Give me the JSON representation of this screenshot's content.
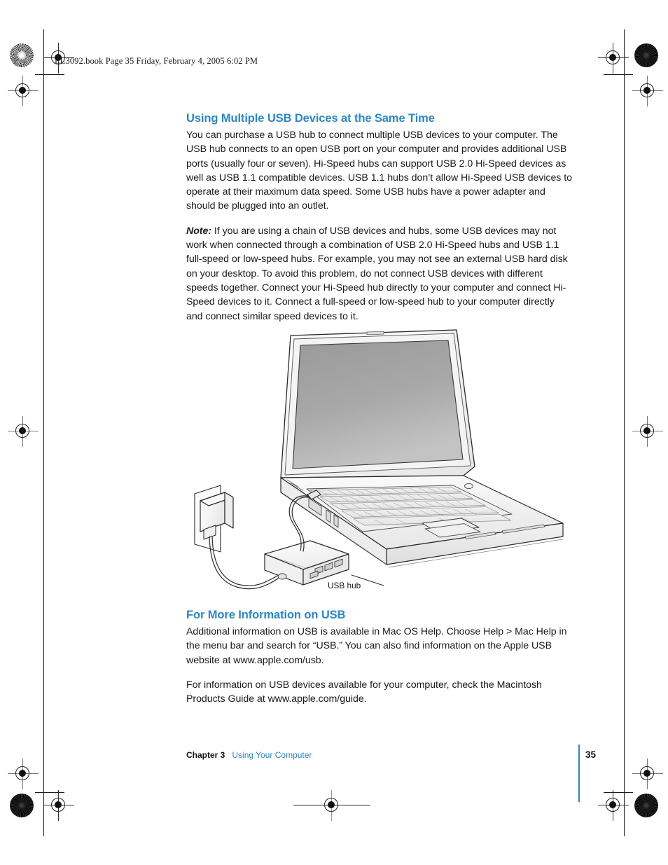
{
  "document": {
    "slug": "LL3092.book  Page 35  Friday, February 4, 2005  6:02 PM"
  },
  "section1": {
    "heading": "Using Multiple USB Devices at the Same Time",
    "paragraph1": "You can purchase a USB hub to connect multiple USB devices to your computer. The USB hub connects to an open USB port on your computer and provides additional USB ports (usually four or seven). Hi-Speed hubs can support USB 2.0 Hi-Speed devices as well as USB 1.1 compatible devices. USB 1.1 hubs don’t allow Hi-Speed USB devices to operate at their maximum data speed. Some USB hubs have a power adapter and should be plugged into an outlet.",
    "note_label": "Note:",
    "note_text": " If you are using a chain of USB devices and hubs, some USB devices may not work when connected through a combination of USB 2.0 Hi-Speed hubs and USB 1.1 full-speed or low-speed hubs. For example, you may not see an external USB hard disk on your desktop. To avoid this problem, do not connect USB devices with different speeds together. Connect your Hi-Speed hub directly to your computer and connect Hi-Speed devices to it. Connect a full-speed or low-speed hub to your computer directly and connect similar speed devices to it."
  },
  "figure": {
    "caption": "USB hub",
    "alt": "Illustration of a PowerBook laptop connected to a USB hub, which is plugged into a power adapter in a wall outlet"
  },
  "section2": {
    "heading": "For More Information on USB",
    "paragraph1": "Additional information on USB is available in Mac OS Help. Choose Help > Mac Help in the menu bar and search for “USB.” You can also find information on the Apple USB website at www.apple.com/usb.",
    "paragraph2": "For information on USB devices available for your computer, check the Macintosh Products Guide at www.apple.com/guide."
  },
  "footer": {
    "chapter": "Chapter 3",
    "chapter_title": "Using Your Computer",
    "page_number": "35"
  },
  "colors": {
    "heading_blue": "#2b86cc",
    "body_black": "#1a1a1a",
    "rule_blue": "#2b86cc"
  }
}
